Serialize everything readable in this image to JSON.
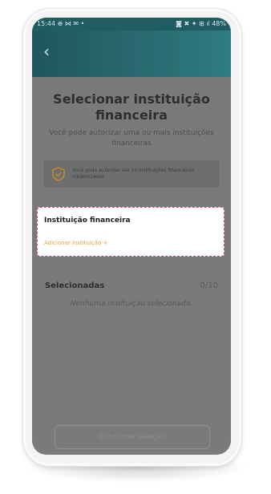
{
  "statusbar": {
    "time": "15:44",
    "left_icons": "⊕ ⋈ ✉ •",
    "battery": "48%",
    "right_icons": "◙ ✖ ✦ ⊞ ıl"
  },
  "header": {
    "back_icon": "chevron-left-icon"
  },
  "page": {
    "title": "Selecionar instituição financeira",
    "subtitle": "Você pode autorizar uma ou mais instituições financeiras"
  },
  "info": {
    "text": "Você pode autorizar até 10 instituições financeiras credenciadas"
  },
  "institution_card": {
    "label": "Instituição financeira",
    "add_link": "Adicionar instituição +"
  },
  "selected": {
    "label": "Selecionadas",
    "count": "0/10",
    "empty_text": "Nenhuma instituição selecionada."
  },
  "footer": {
    "confirm_label": "Confirmar seleção"
  },
  "colors": {
    "header": "#1f5c63",
    "accent": "#e0a23a",
    "highlight_border": "#c9407a"
  }
}
